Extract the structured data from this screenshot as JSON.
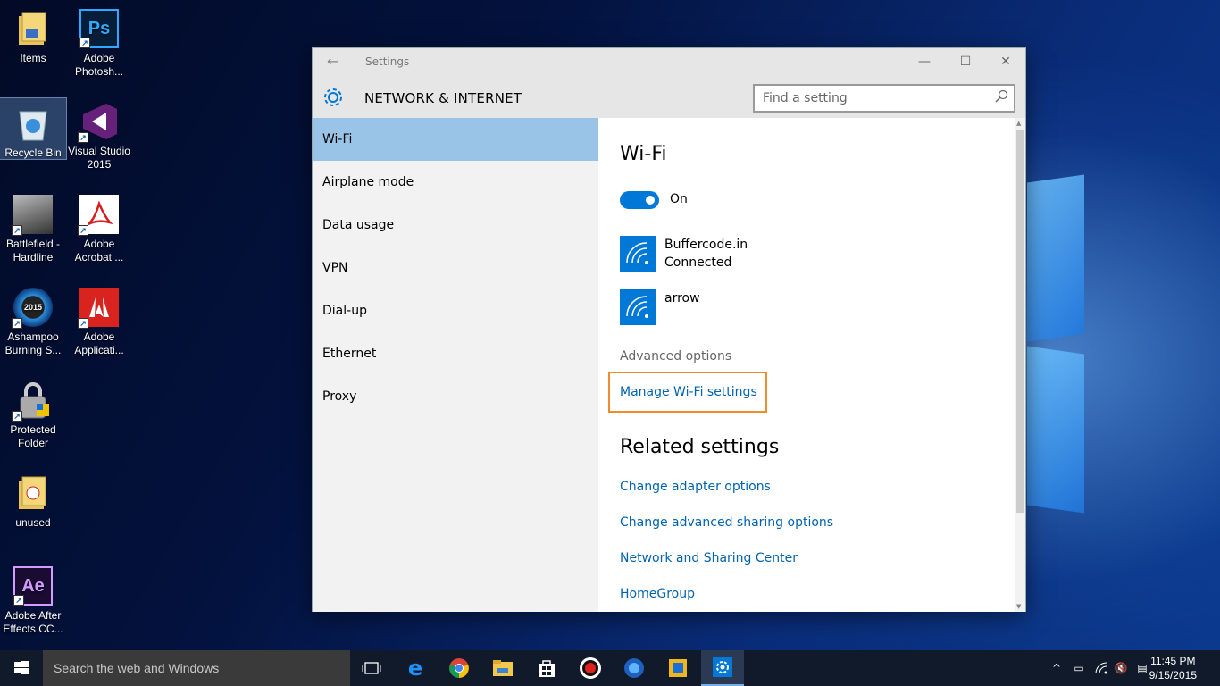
{
  "desktop": {
    "icons": [
      {
        "label": "Items",
        "glyph": "folder-icon"
      },
      {
        "label": "Adobe Photosh...",
        "glyph": "photoshop-icon",
        "text": "Ps"
      },
      {
        "label": "Recycle Bin",
        "glyph": "recycle-bin-icon"
      },
      {
        "label": "Visual Studio 2015",
        "glyph": "visual-studio-icon"
      },
      {
        "label": "Battlefield - Hardline",
        "glyph": "battlefield-icon"
      },
      {
        "label": "Adobe Acrobat ...",
        "glyph": "acrobat-icon"
      },
      {
        "label": "Ashampoo Burning S...",
        "glyph": "ashampoo-icon",
        "text": "2015"
      },
      {
        "label": "Adobe Applicati...",
        "glyph": "adobe-app-manager-icon"
      },
      {
        "label": "Protected Folder",
        "glyph": "lock-icon"
      },
      {
        "label": "unused",
        "glyph": "folder-icon"
      },
      {
        "label": "Adobe After Effects CC...",
        "glyph": "after-effects-icon",
        "text": "Ae"
      }
    ]
  },
  "window": {
    "title": "Settings",
    "section": "NETWORK & INTERNET",
    "search_placeholder": "Find a setting"
  },
  "sidebar": {
    "items": [
      {
        "label": "Wi-Fi",
        "active": true
      },
      {
        "label": "Airplane mode"
      },
      {
        "label": "Data usage"
      },
      {
        "label": "VPN"
      },
      {
        "label": "Dial-up"
      },
      {
        "label": "Ethernet"
      },
      {
        "label": "Proxy"
      }
    ]
  },
  "content": {
    "heading": "Wi-Fi",
    "toggle_label": "On",
    "networks": [
      {
        "name": "Buffercode.in",
        "status": "Connected"
      },
      {
        "name": "arrow",
        "status": ""
      }
    ],
    "advanced_label": "Advanced options",
    "manage_link": "Manage Wi-Fi settings",
    "related_heading": "Related settings",
    "related_links": [
      "Change adapter options",
      "Change advanced sharing options",
      "Network and Sharing Center",
      "HomeGroup"
    ]
  },
  "taskbar": {
    "search_placeholder": "Search the web and Windows",
    "time": "11:45 PM",
    "date": "9/15/2015"
  },
  "colors": {
    "accent": "#0078d7",
    "link": "#0063b1",
    "highlight_box": "#f08c2e",
    "sidebar_active": "#99c4e8"
  }
}
